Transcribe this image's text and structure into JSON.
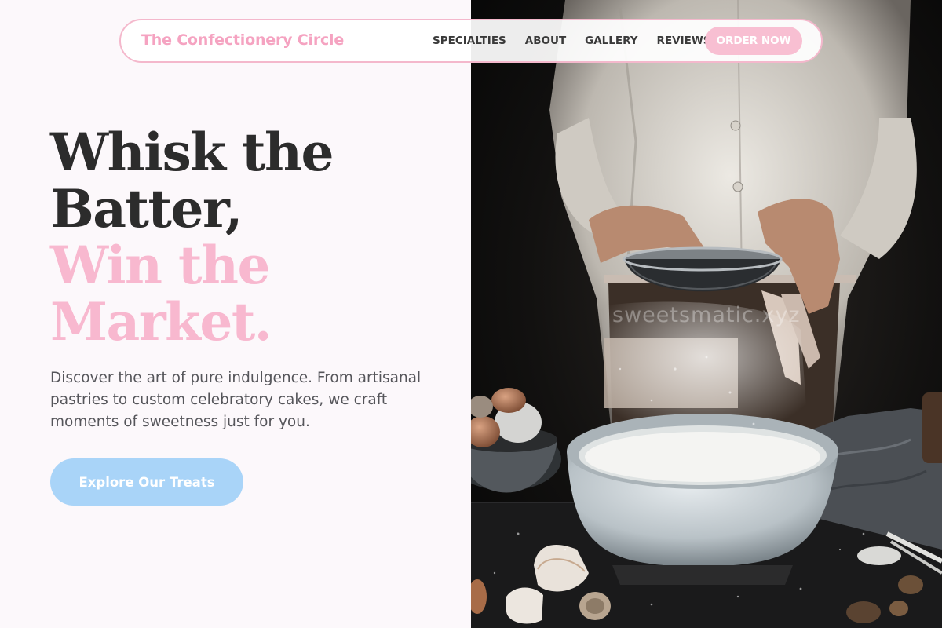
{
  "brand": {
    "name": "The Confectionery Circle"
  },
  "nav": {
    "links": [
      {
        "label": "SPECIALTIES"
      },
      {
        "label": "ABOUT"
      },
      {
        "label": "GALLERY"
      },
      {
        "label": "REVIEWS"
      }
    ],
    "cta_label": "ORDER NOW"
  },
  "hero": {
    "headline_line1": "Whisk the",
    "headline_line2": "Batter,",
    "headline_line3": "Win the",
    "headline_line4": "Market.",
    "description": "Discover the art of pure indulgence. From artisanal pastries to custom celebratory cakes, we craft moments of sweetness just for you.",
    "cta_label": "Explore Our Treats",
    "watermark": "sweetsmatic.xyz"
  },
  "colors": {
    "accent_pink": "#f8b8cf",
    "brand_pink": "#f5a3c1",
    "cta_blue": "#a9d4f8",
    "heading_dark": "#2c2c2c",
    "body_text": "#55555a",
    "nav_border": "#f4b8cc"
  },
  "icons": {
    "hero_image": "baker-sifting-flour-photo"
  }
}
